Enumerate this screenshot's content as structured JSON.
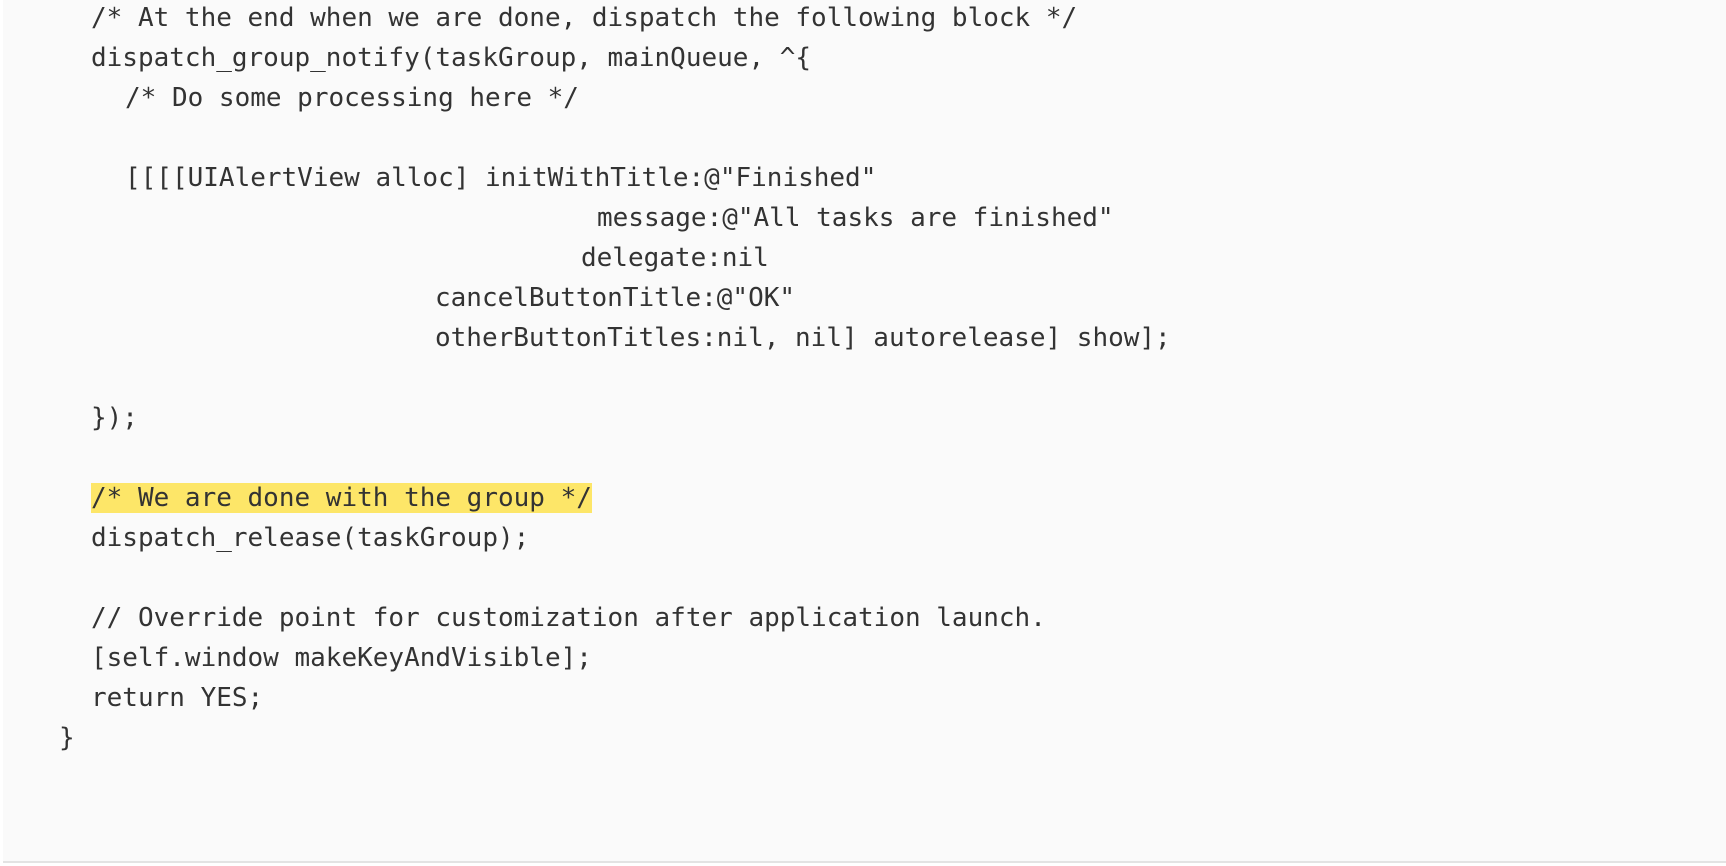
{
  "code": {
    "lines": [
      "  /* At the end when we are done, dispatch the following block */",
      "  dispatch_group_notify(taskGroup, mainQueue, ^{",
      "    /* Do some processing here */",
      "",
      "    [[[[UIAlertView alloc] initWithTitle:@\"Finished\"",
      "                             message:@\"All tasks are finished\"",
      "                            delegate:nil",
      "                   cancelButtonTitle:@\"OK\"",
      "                   otherButtonTitles:nil, nil] autorelease] show];",
      "",
      "  });",
      "",
      "  /* We are done with the group */",
      "  dispatch_release(taskGroup);",
      "",
      "  // Override point for customization after application launch.",
      "  [self.window makeKeyAndVisible];",
      "  return YES;",
      "}"
    ],
    "highlight_color": "#fde668",
    "background_color": "#fafafa",
    "text_color": "#333333"
  }
}
